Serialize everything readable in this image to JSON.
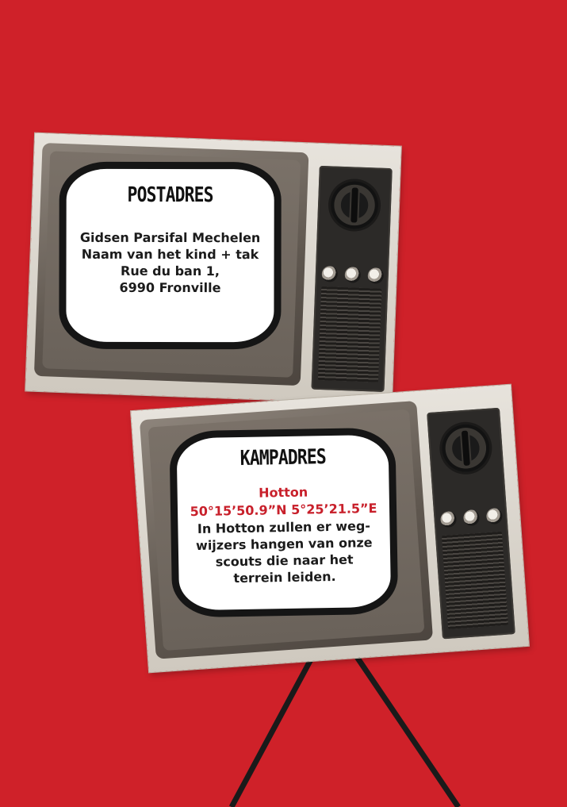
{
  "postadres": {
    "title": "POSTADRES",
    "lines": [
      "Gidsen Parsifal Mechelen",
      "Naam van het kind + tak",
      "Rue du ban 1,",
      "6990 Fronville"
    ]
  },
  "kampadres": {
    "title": "KAMPADRES",
    "place": "Hotton",
    "coordinates": "50°15’50.9”N 5°25’21.5”E",
    "lines": [
      "In Hotton zullen er weg-",
      "wijzers hangen van onze",
      "scouts die naar het",
      "terrein leiden."
    ]
  },
  "colors": {
    "background": "#cf2129",
    "accent_text": "#c8202b",
    "screen": "#ffffff"
  },
  "icons": {
    "tv": "retro-tv-icon",
    "knob": "dial-knob-icon"
  }
}
